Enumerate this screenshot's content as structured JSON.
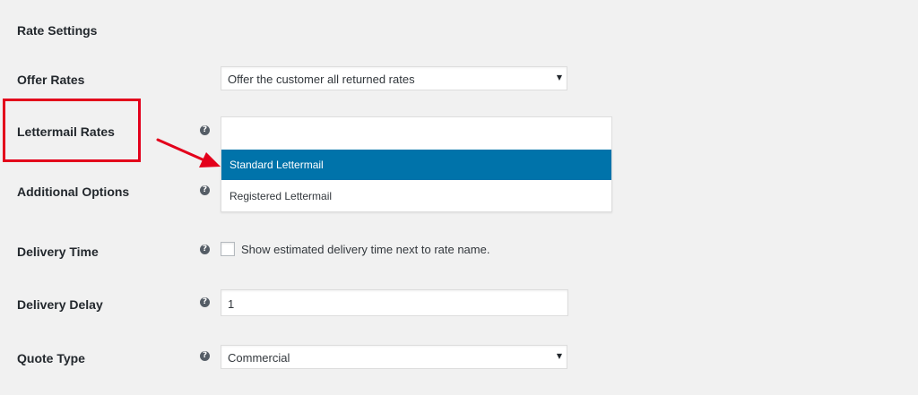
{
  "section": {
    "title": "Rate Settings"
  },
  "offer_rates": {
    "label": "Offer Rates",
    "selected": "Offer the customer all returned rates"
  },
  "lettermail_rates": {
    "label": "Lettermail Rates",
    "help_icon": "question-circle-icon",
    "input_value": "",
    "options": [
      "Standard Lettermail",
      "Registered Lettermail"
    ],
    "highlighted_index": 0
  },
  "additional_options": {
    "label": "Additional Options",
    "help_icon": "question-circle-icon"
  },
  "delivery_time": {
    "label": "Delivery Time",
    "help_icon": "question-circle-icon",
    "checkbox_label": "Show estimated delivery time next to rate name.",
    "checked": false
  },
  "delivery_delay": {
    "label": "Delivery Delay",
    "help_icon": "question-circle-icon",
    "value": "1"
  },
  "quote_type": {
    "label": "Quote Type",
    "help_icon": "question-circle-icon",
    "selected": "Commercial"
  },
  "glyphs": {
    "help": "?",
    "select_arrow": "▼"
  },
  "colors": {
    "background": "#f1f1f1",
    "highlight_option": "#0073aa",
    "annotation_red": "#e3001b"
  }
}
